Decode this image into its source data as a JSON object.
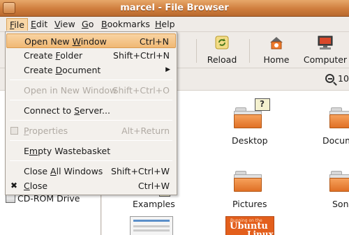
{
  "window": {
    "title": "marcel - File Browser"
  },
  "menubar": [
    {
      "label": "File",
      "mnemonic": "F",
      "rest": "ile"
    },
    {
      "label": "Edit",
      "mnemonic": "E",
      "rest": "dit"
    },
    {
      "label": "View",
      "mnemonic": "V",
      "rest": "iew"
    },
    {
      "label": "Go",
      "mnemonic": "G",
      "rest": "o"
    },
    {
      "label": "Bookmarks",
      "mnemonic": "B",
      "rest": "ookmarks"
    },
    {
      "label": "Help",
      "mnemonic": "H",
      "rest": "elp"
    }
  ],
  "toolbar": {
    "stop_partial": "p",
    "reload_label": "Reload",
    "home_label": "Home",
    "computer_label": "Computer"
  },
  "location": {
    "zoom_partial": "10"
  },
  "file_menu": {
    "open_new_window": {
      "pre": "Open New ",
      "mn": "W",
      "post": "indow",
      "accel": "Ctrl+N"
    },
    "create_folder": {
      "pre": "Create ",
      "mn": "F",
      "post": "older",
      "accel": "Shift+Ctrl+N"
    },
    "create_document": {
      "pre": "Create ",
      "mn": "D",
      "post": "ocument"
    },
    "open_in_new_window": {
      "label": "Open in New Window",
      "accel": "Shift+Ctrl+O"
    },
    "connect_to_server": {
      "pre": "Connect to ",
      "mn": "S",
      "post": "erver..."
    },
    "properties": {
      "pre": "",
      "mn": "P",
      "post": "roperties",
      "accel": "Alt+Return"
    },
    "empty_wastebasket": {
      "pre": "E",
      "mn": "m",
      "post": "pty Wastebasket"
    },
    "close_all_windows": {
      "pre": "Close ",
      "mn": "A",
      "post": "ll Windows",
      "accel": "Shift+Ctrl+W"
    },
    "close": {
      "pre": "",
      "mn": "C",
      "post": "lose",
      "accel": "Ctrl+W"
    }
  },
  "sidebar": {
    "cdrom": "CD-ROM Drive"
  },
  "files": [
    {
      "name": "Desktop"
    },
    {
      "name": "Docum"
    },
    {
      "name": "Examples"
    },
    {
      "name": "Pictures"
    },
    {
      "name": "Son"
    }
  ],
  "thumbnail": {
    "small": "Running on the",
    "big1": "Ubuntu",
    "big2": "Linux"
  },
  "colors": {
    "titlebar": "#cf7d3d",
    "folder": "#e07025",
    "highlight": "#f0b874"
  }
}
